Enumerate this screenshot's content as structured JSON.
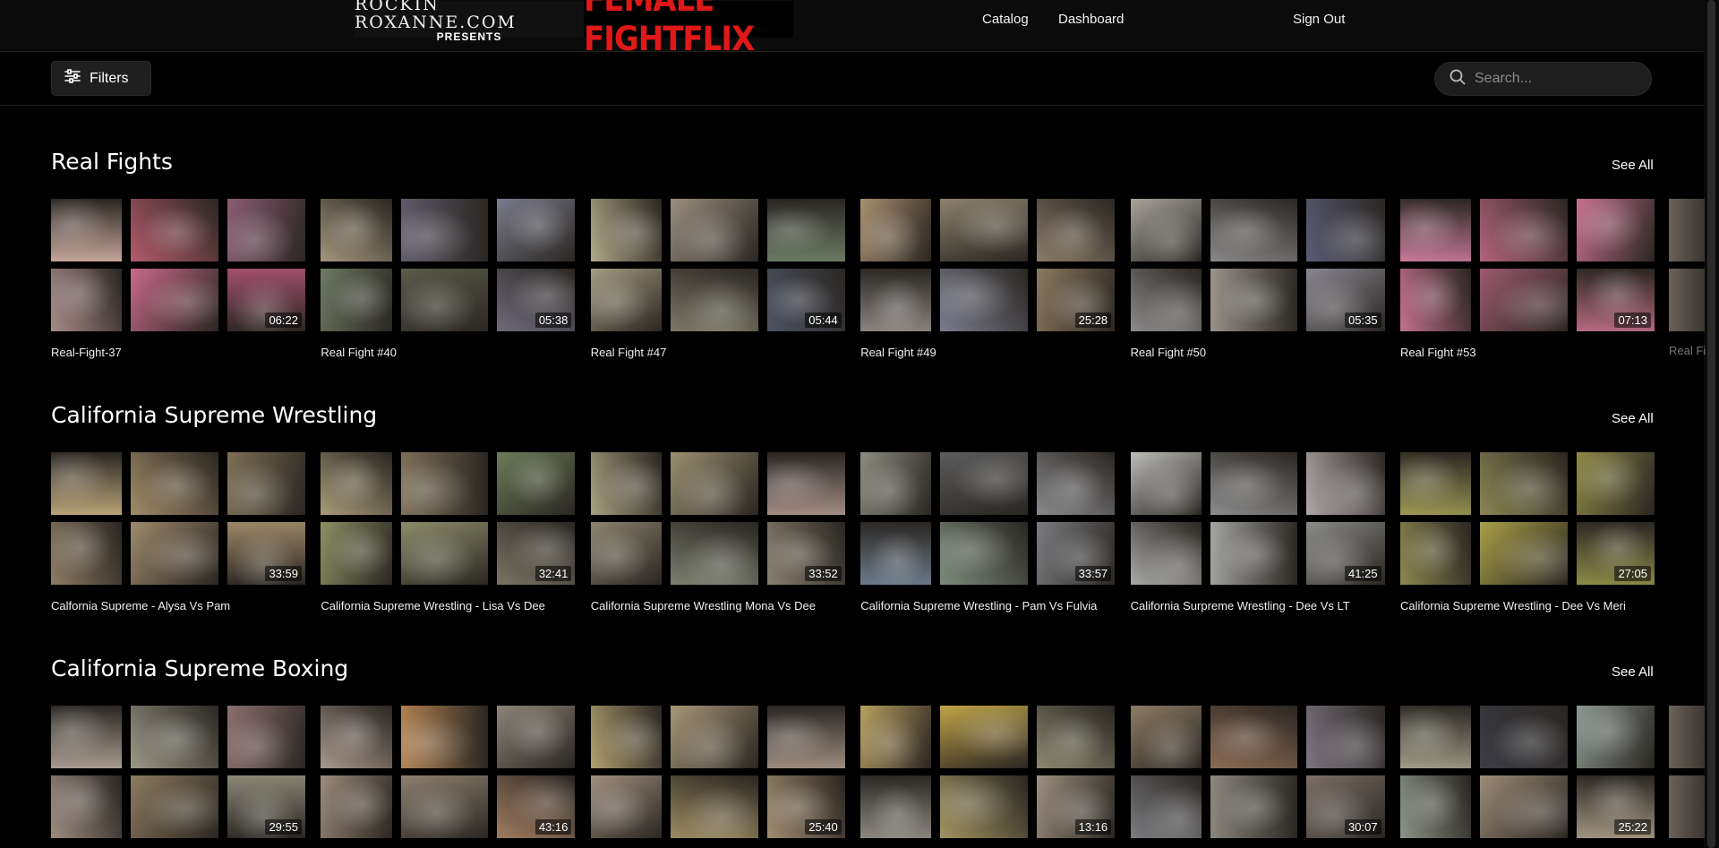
{
  "header": {
    "logo_line1": "ROCKIN ROXANNE.COM",
    "logo_line2": "PRESENTS",
    "logo_brand": "FEMALE FIGHTFLIX",
    "nav": [
      {
        "label": "Catalog"
      },
      {
        "label": "Dashboard"
      },
      {
        "label": "Sign Out"
      }
    ]
  },
  "toolbar": {
    "filters_label": "Filters",
    "search_placeholder": "Search..."
  },
  "sections": [
    {
      "title": "Real Fights",
      "see_all": "See All",
      "cards": [
        {
          "title": "Real-Fight-37",
          "duration": "06:22",
          "tones": [
            "#c5a59a",
            "#a78c88",
            "#b35a6b",
            "#c86a8a",
            "#8a5d74",
            "#a3506e"
          ]
        },
        {
          "title": "Real Fight #40",
          "duration": "05:38",
          "tones": [
            "#a3977c",
            "#6f7a64",
            "#5f5a6a",
            "#5b5b4b",
            "#7b7c8c",
            "#6e6a7a"
          ]
        },
        {
          "title": "Real Fight #47",
          "duration": "05:44",
          "tones": [
            "#b0a888",
            "#a59c83",
            "#9a8f80",
            "#7c7868",
            "#6a7a64",
            "#4e5464"
          ]
        },
        {
          "title": "Real Fight #49",
          "duration": "25:28",
          "tones": [
            "#a89070",
            "#8a8480",
            "#8c826e",
            "#7a7c8c",
            "#8a7c68",
            "#8a7a60"
          ]
        },
        {
          "title": "Real Fight #50",
          "duration": "05:35",
          "tones": [
            "#a8a49c",
            "#8c8a8a",
            "#8a8888",
            "#9a948c",
            "#5a5c74",
            "#8a8690"
          ]
        },
        {
          "title": "Real Fight #53",
          "duration": "07:13",
          "tones": [
            "#c87a9a",
            "#c4708e",
            "#b3647c",
            "#9c5a6e",
            "#c87090",
            "#b56a80"
          ]
        }
      ],
      "peek_title": "Real Fi"
    },
    {
      "title": "California Supreme Wrestling",
      "see_all": "See All",
      "cards": [
        {
          "title": "Calfornia Supreme - Alysa Vs Pam",
          "duration": "33:59",
          "tones": [
            "#b8a478",
            "#8c7c64",
            "#a08c68",
            "#9c8a6c",
            "#7c7054",
            "#9c8868"
          ]
        },
        {
          "title": "California Supreme Wrestling - Lisa Vs Dee",
          "duration": "32:41",
          "tones": [
            "#a89c78",
            "#8c9064",
            "#7c7058",
            "#8c8c6a",
            "#6c7c58",
            "#7a7464"
          ]
        },
        {
          "title": "California Supreme Wrestling Mona Vs Dee",
          "duration": "33:52",
          "tones": [
            "#a8a080",
            "#8c8470",
            "#9a9070",
            "#7c8070",
            "#a08c84",
            "#8a8070"
          ]
        },
        {
          "title": "California Supreme Wrestling - Pam Vs Fulvia",
          "duration": "33:57",
          "tones": [
            "#8c8c80",
            "#6c7a88",
            "#5c5c5c",
            "#7c8c7c",
            "#8a8a8c",
            "#7c7c80"
          ]
        },
        {
          "title": "California Surpreme Wrestling - Dee Vs LT",
          "duration": "41:25",
          "tones": [
            "#bcbcb8",
            "#a8a8a4",
            "#8c8c8c",
            "#a4a4a0",
            "#b0a8a8",
            "#8c8c88"
          ]
        },
        {
          "title": "California Supreme Wrestling - Dee Vs Meri",
          "duration": "27:05",
          "tones": [
            "#9c9854",
            "#8c8850",
            "#8a8654",
            "#a8a048",
            "#8c8844",
            "#8c8a48"
          ]
        }
      ]
    },
    {
      "title": "California Supreme Boxing",
      "see_all": "See All",
      "cards": [
        {
          "title": "",
          "duration": "29:55",
          "tones": [
            "#a89c90",
            "#9c8c80",
            "#9c9888",
            "#8c7c60",
            "#8c7070",
            "#8c8878"
          ]
        },
        {
          "title": "",
          "duration": "43:16",
          "tones": [
            "#a8988c",
            "#9c8c7c",
            "#b08050",
            "#8c8070",
            "#8c8478",
            "#a07c60"
          ]
        },
        {
          "title": "",
          "duration": "25:40",
          "tones": [
            "#b0a070",
            "#a09080",
            "#a89878",
            "#9c8c60",
            "#9c8c80",
            "#a08c70"
          ]
        },
        {
          "title": "",
          "duration": "13:16",
          "tones": [
            "#b8a060",
            "#8c8880",
            "#c0a448",
            "#a09460",
            "#8c8870",
            "#9c9080"
          ]
        },
        {
          "title": "",
          "duration": "30:07",
          "tones": [
            "#8c7c64",
            "#7c7c80",
            "#8c6c54",
            "#8c8880",
            "#7c7480",
            "#7c7068"
          ]
        },
        {
          "title": "",
          "duration": "25:22",
          "tones": [
            "#a09c88",
            "#8c9488",
            "#3c3c44",
            "#9c8c78",
            "#8c9890",
            "#a09480"
          ]
        }
      ]
    }
  ],
  "icons": {
    "filters": "sliders-icon",
    "search": "search-icon",
    "next": "chevron-right-icon"
  },
  "colors": {
    "background": "#000000",
    "brand_red": "#e01818",
    "button_bg": "#1f1f1f"
  }
}
